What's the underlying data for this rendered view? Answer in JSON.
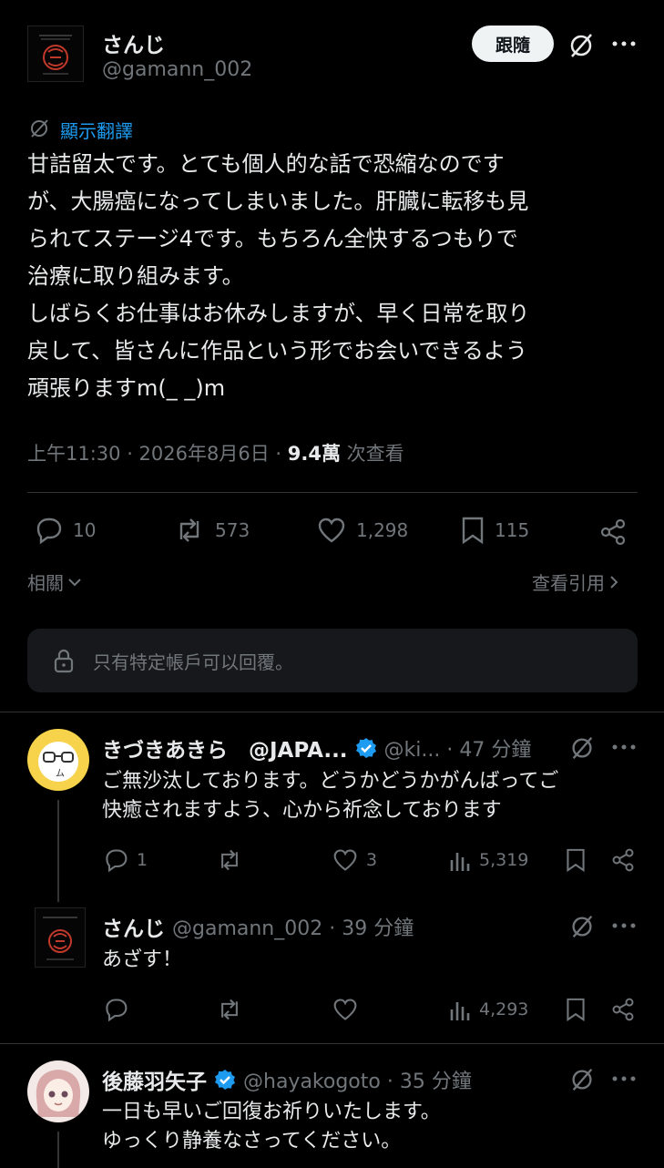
{
  "main_post": {
    "author_name": "さんじ",
    "author_handle": "@gamann_002",
    "follow_label": "跟隨",
    "translate_label": "顯示翻譯",
    "body": "甘詰留太です。とても個人的な話で恐縮なのです\nが、大腸癌になってしまいました。肝臓に転移も見\nられてステージ4です。もちろん全快するつもりで\n治療に取り組みます。\nしばらくお仕事はお休みしますが、早く日常を取り\n戻して、皆さんに作品という形でお会いできるよう\n頑張りますm(_ _)m",
    "timestamp": "上午11:30 · 2026年8月6日 · ",
    "views_count": "9.4萬",
    "views_label": " 次查看",
    "stats": {
      "replies": "10",
      "reposts": "573",
      "likes": "1,298",
      "bookmarks": "115"
    },
    "related_label": "相關",
    "view_quotes_label": "查看引用",
    "reply_restriction": "只有特定帳戶可以回覆。"
  },
  "replies": [
    {
      "name": "きづきあきら　@JAPA...",
      "handle_time": "@ki... · 47 分鐘",
      "text": "ご無沙汰しております。どうかどうかがんばってご\n快癒されますよう、心から祈念しております",
      "stats": {
        "replies": "1",
        "reposts": "",
        "likes": "3",
        "views": "5,319"
      }
    },
    {
      "name": "さんじ",
      "handle_time": "@gamann_002 · 39 分鐘",
      "text": "あざす！",
      "stats": {
        "replies": "",
        "reposts": "",
        "likes": "",
        "views": "4,293"
      }
    },
    {
      "name": "後藤羽矢子",
      "handle_time": "@hayakogoto · 35 分鐘",
      "text": "一日も早いご回復お祈りいたします。\nゆっくり静養なさってください。"
    }
  ],
  "colors": {
    "background": "#000000",
    "text": "#e7e9ea",
    "secondary_text": "#71767b",
    "link_blue": "#1d9bf0",
    "verified_blue": "#1d9bf0",
    "divider": "#2f3336"
  }
}
